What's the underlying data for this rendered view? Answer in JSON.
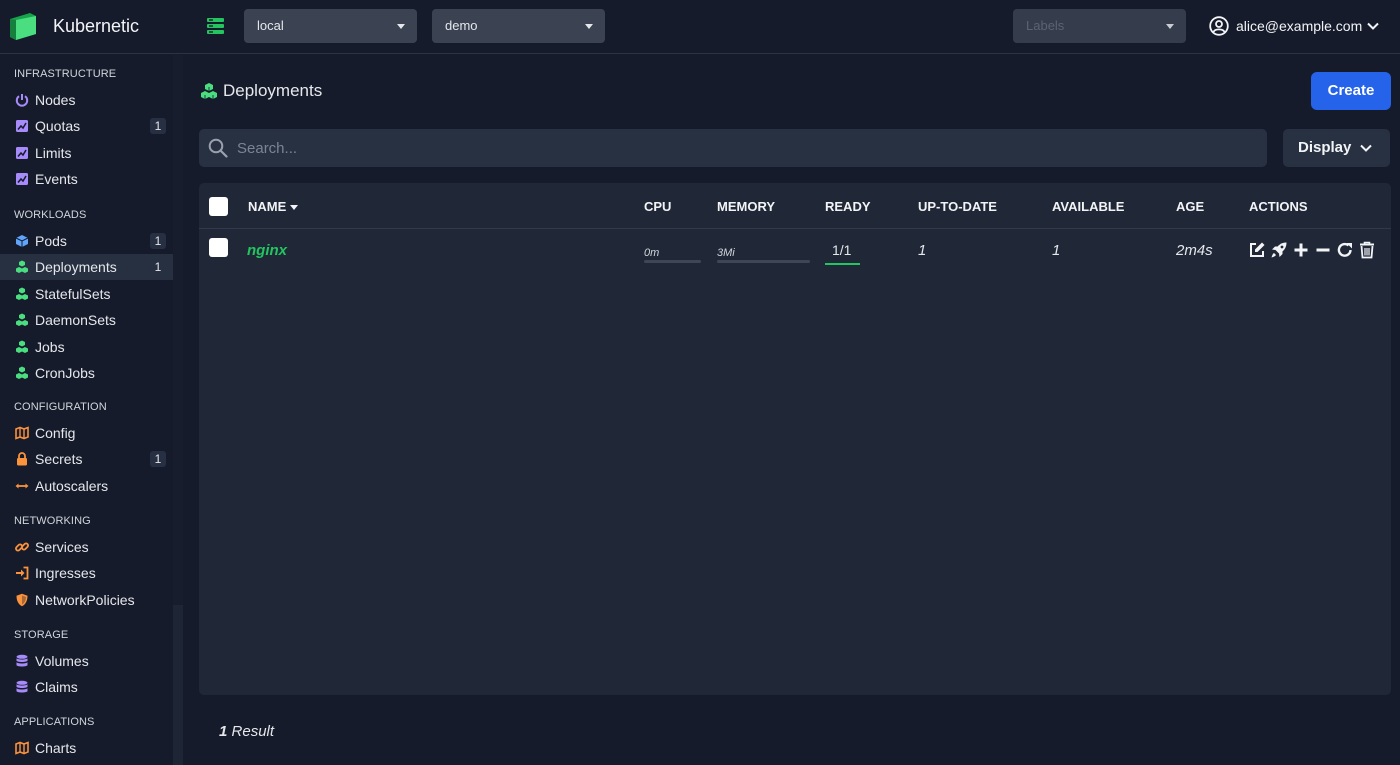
{
  "app": {
    "title": "Kubernetic"
  },
  "topbar": {
    "cluster_select": "local",
    "namespace_select": "demo",
    "labels_placeholder": "Labels",
    "user": "alice@example.com"
  },
  "sidebar": {
    "sections": [
      {
        "label": "INFRASTRUCTURE",
        "items": [
          {
            "label": "Nodes",
            "icon": "power-icon",
            "badge": ""
          },
          {
            "label": "Quotas",
            "icon": "chart-icon",
            "badge": "1"
          },
          {
            "label": "Limits",
            "icon": "chart-icon",
            "badge": ""
          },
          {
            "label": "Events",
            "icon": "chart-icon",
            "badge": ""
          }
        ]
      },
      {
        "label": "WORKLOADS",
        "items": [
          {
            "label": "Pods",
            "icon": "cube-icon",
            "badge": "1"
          },
          {
            "label": "Deployments",
            "icon": "cubes-icon",
            "badge": "1",
            "active": true
          },
          {
            "label": "StatefulSets",
            "icon": "cubes-icon",
            "badge": ""
          },
          {
            "label": "DaemonSets",
            "icon": "cubes-icon",
            "badge": ""
          },
          {
            "label": "Jobs",
            "icon": "cubes-icon",
            "badge": ""
          },
          {
            "label": "CronJobs",
            "icon": "cubes-icon",
            "badge": ""
          }
        ]
      },
      {
        "label": "CONFIGURATION",
        "items": [
          {
            "label": "Config",
            "icon": "map-icon",
            "badge": ""
          },
          {
            "label": "Secrets",
            "icon": "lock-icon",
            "badge": "1"
          },
          {
            "label": "Autoscalers",
            "icon": "arrows-h-icon",
            "badge": ""
          }
        ]
      },
      {
        "label": "NETWORKING",
        "items": [
          {
            "label": "Services",
            "icon": "link-icon",
            "badge": ""
          },
          {
            "label": "Ingresses",
            "icon": "sign-in-icon",
            "badge": ""
          },
          {
            "label": "NetworkPolicies",
            "icon": "shield-icon",
            "badge": ""
          }
        ]
      },
      {
        "label": "STORAGE",
        "items": [
          {
            "label": "Volumes",
            "icon": "database-icon",
            "badge": ""
          },
          {
            "label": "Claims",
            "icon": "database-icon",
            "badge": ""
          }
        ]
      },
      {
        "label": "APPLICATIONS",
        "items": [
          {
            "label": "Charts",
            "icon": "map-icon",
            "badge": ""
          }
        ]
      }
    ]
  },
  "main": {
    "title": "Deployments",
    "create_label": "Create",
    "search_placeholder": "Search...",
    "display_label": "Display",
    "columns": [
      "NAME",
      "CPU",
      "MEMORY",
      "READY",
      "UP-TO-DATE",
      "AVAILABLE",
      "AGE",
      "ACTIONS"
    ],
    "rows": [
      {
        "name": "nginx",
        "cpu": "0m",
        "cpu_usage": 0,
        "memory": "3Mi",
        "memory_usage": 0,
        "ready": "1/1",
        "ready_fraction": 1.0,
        "up_to_date": "1",
        "available": "1",
        "age": "2m4s"
      }
    ],
    "actions": [
      "edit-icon",
      "rocket-icon",
      "plus-icon",
      "minus-icon",
      "redo-icon",
      "trash-icon"
    ],
    "result_count": "1",
    "result_label": "Result"
  },
  "colors": {
    "accent": "#2563eb",
    "green": "#22c55e",
    "background": "#151b2b",
    "panel": "#202838"
  }
}
